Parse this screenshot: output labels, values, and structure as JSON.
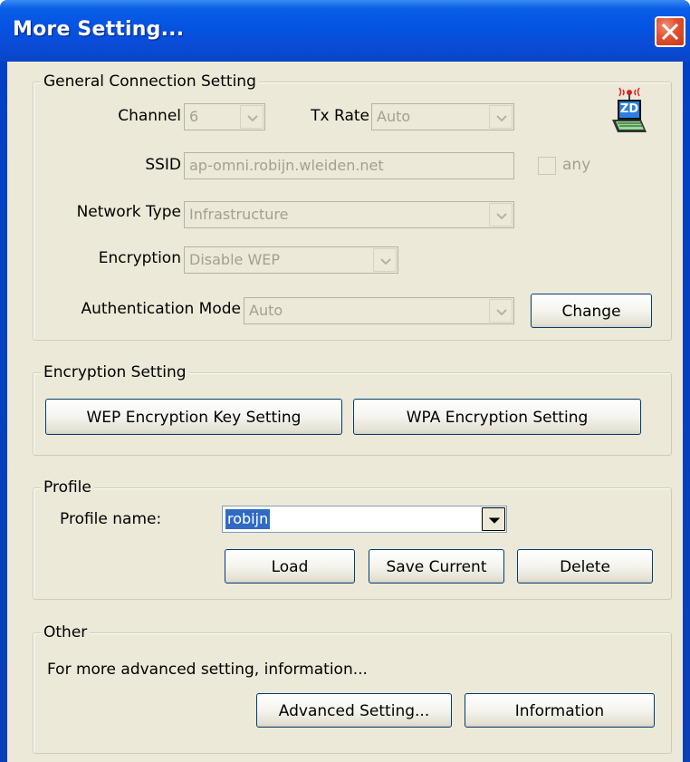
{
  "window": {
    "title": "More Setting...",
    "close_label": "close"
  },
  "general": {
    "group_label": "General Connection Setting",
    "channel_label": "Channel",
    "channel_value": "6",
    "txrate_label": "Tx Rate",
    "txrate_value": "Auto",
    "ssid_label": "SSID",
    "ssid_value": "ap-omni.robijn.wleiden.net",
    "any_label": "any",
    "any_checked": false,
    "network_type_label": "Network Type",
    "network_type_value": "Infrastructure",
    "encryption_label": "Encryption",
    "encryption_value": "Disable WEP",
    "auth_mode_label": "Authentication Mode",
    "auth_mode_value": "Auto",
    "change_button": "Change",
    "logo_text": "ZD"
  },
  "encryption_setting": {
    "group_label": "Encryption Setting",
    "wep_button": "WEP Encryption Key Setting",
    "wpa_button": "WPA Encryption Setting"
  },
  "profile": {
    "group_label": "Profile",
    "name_label": "Profile name:",
    "name_value": "robijn",
    "load_button": "Load",
    "save_button": "Save Current",
    "delete_button": "Delete"
  },
  "other": {
    "group_label": "Other",
    "description": "For more advanced setting, information...",
    "advanced_button": "Advanced Setting...",
    "information_button": "Information"
  },
  "colors": {
    "titlebar": "#0554e3",
    "dialog_bg": "#ece9d8",
    "selection": "#316ac5",
    "close": "#e0502e",
    "disabled_text": "#a3a08f"
  }
}
